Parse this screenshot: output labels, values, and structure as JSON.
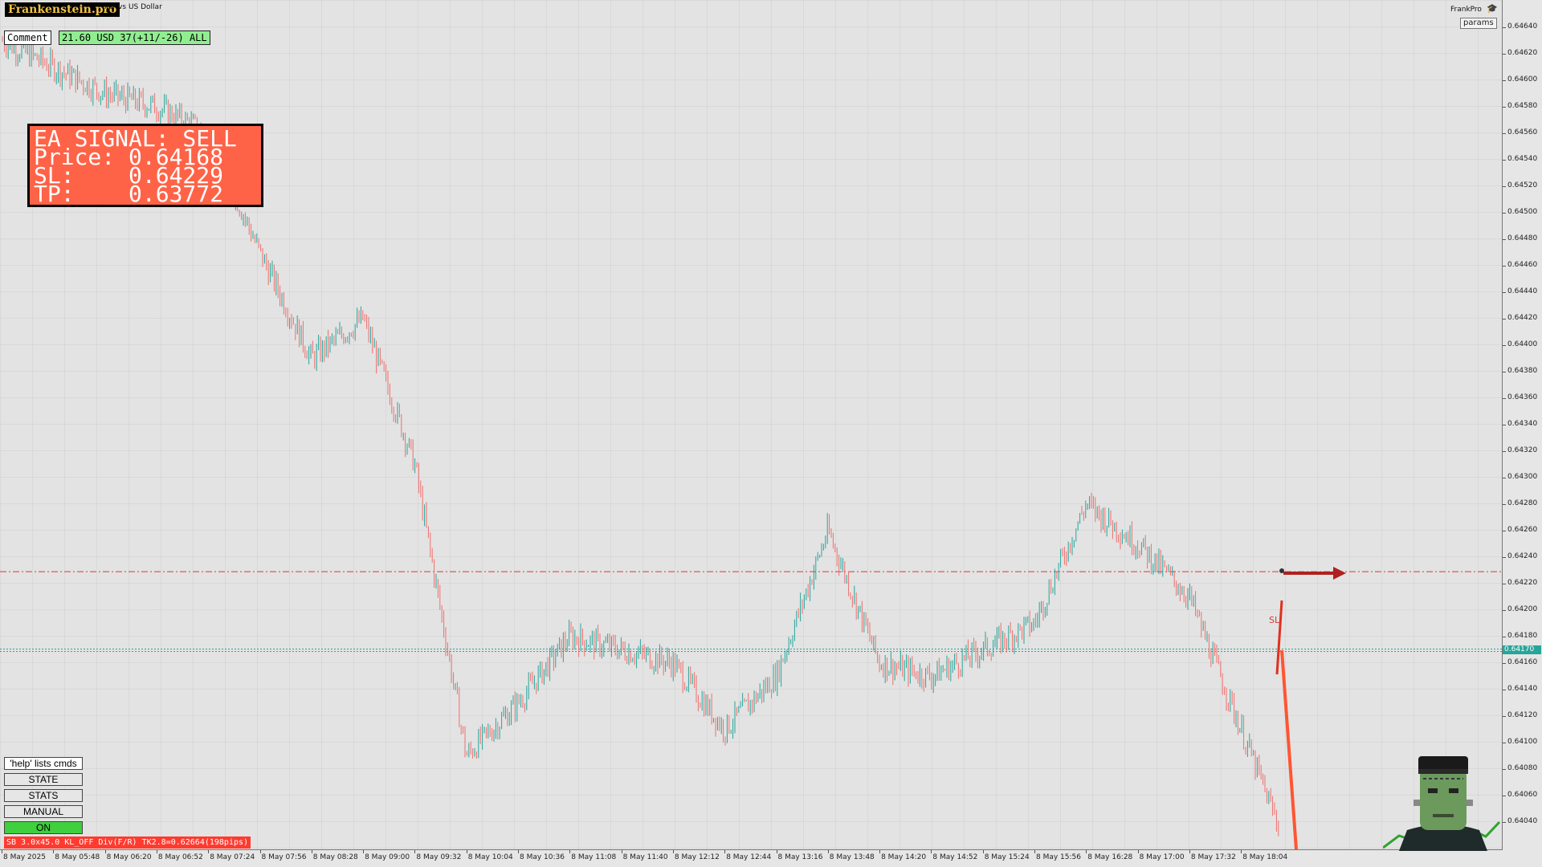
{
  "header": {
    "logo_text": "Frankenstein.pro",
    "symbol_description": "llar vs US Dollar",
    "brand_label": "FrankPro",
    "params_button": "params"
  },
  "comment": {
    "label": "Comment",
    "value": "21.60 USD 37(+11/-26) ALL"
  },
  "signal": {
    "line1": "EA SIGNAL: SELL",
    "line2": "Price: 0.64168",
    "line3": "SL:    0.64229",
    "line4": "TP:    0.63772"
  },
  "controls": {
    "help_hint": "'help' lists cmds",
    "state": "STATE",
    "stats": "STATS",
    "manual": "MANUAL",
    "on": "ON"
  },
  "status_bar": "SB 3.0x45.0 KL_OFF Div(F/R) TK2.8=0.62664(198pips)",
  "price_axis": {
    "labels": [
      "0.64640",
      "0.64620",
      "0.64600",
      "0.64580",
      "0.64560",
      "0.64540",
      "0.64520",
      "0.64500",
      "0.64480",
      "0.64460",
      "0.64440",
      "0.64420",
      "0.64400",
      "0.64380",
      "0.64360",
      "0.64340",
      "0.64320",
      "0.64300",
      "0.64280",
      "0.64260",
      "0.64240",
      "0.64220",
      "0.64200",
      "0.64180",
      "0.64160",
      "0.64140",
      "0.64120",
      "0.64100",
      "0.64080",
      "0.64060",
      "0.64040"
    ],
    "current_price": "0.64170"
  },
  "time_axis": {
    "labels": [
      "8 May 2025",
      "8 May 05:48",
      "8 May 06:20",
      "8 May 06:52",
      "8 May 07:24",
      "8 May 07:56",
      "8 May 08:28",
      "8 May 09:00",
      "8 May 09:32",
      "8 May 10:04",
      "8 May 10:36",
      "8 May 11:08",
      "8 May 11:40",
      "8 May 12:12",
      "8 May 12:44",
      "8 May 13:16",
      "8 May 13:48",
      "8 May 14:20",
      "8 May 14:52",
      "8 May 15:24",
      "8 May 15:56",
      "8 May 16:28",
      "8 May 17:00",
      "8 May 17:32",
      "8 May 18:04"
    ]
  },
  "chart_data": {
    "type": "candlestick",
    "symbol_description": "llar vs US Dollar",
    "ylim": [
      0.64025,
      0.6466
    ],
    "sl_level": 0.64229,
    "entry_level": 0.6417,
    "tp_level": 0.63772,
    "colors": {
      "bull": "#26a69a",
      "bear": "#ef6f6c",
      "sl_line": "#d43a3a",
      "price_line": "#26a69a"
    },
    "close_path_x": [
      "8 May 2025",
      "8 May 05:48",
      "8 May 06:20",
      "8 May 06:52",
      "8 May 07:24",
      "8 May 07:56",
      "8 May 08:28",
      "8 May 09:00",
      "8 May 09:32",
      "8 May 10:04",
      "8 May 10:36",
      "8 May 11:08",
      "8 May 11:40",
      "8 May 12:12",
      "8 May 12:44",
      "8 May 13:16",
      "8 May 13:48",
      "8 May 14:20",
      "8 May 14:52",
      "8 May 15:24",
      "8 May 15:56",
      "8 May 16:28",
      "8 May 17:00",
      "8 May 17:32",
      "8 May 18:04"
    ],
    "close_path_y": [
      0.6463,
      0.6461,
      0.6459,
      0.6458,
      0.6456,
      0.6447,
      0.6439,
      0.6442,
      0.6431,
      0.6409,
      0.6413,
      0.6418,
      0.6417,
      0.6416,
      0.6411,
      0.6415,
      0.6426,
      0.6416,
      0.6415,
      0.6417,
      0.6419,
      0.6428,
      0.6425,
      0.6421,
      0.6411
    ]
  }
}
